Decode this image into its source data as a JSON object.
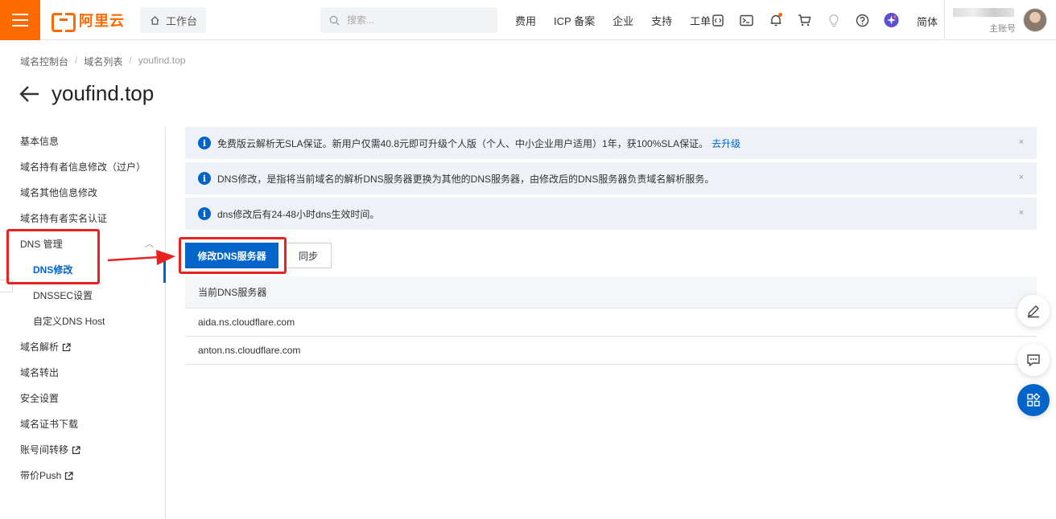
{
  "topbar": {
    "logo_text": "阿里云",
    "workbench_label": "工作台",
    "search_placeholder": "搜索...",
    "nav_links": [
      "费用",
      "ICP 备案",
      "企业",
      "支持",
      "工单"
    ],
    "language": "简体",
    "account_sub": "主账号",
    "accent_color": "#ff6a00"
  },
  "breadcrumb": [
    "域名控制台",
    "域名列表",
    "youfind.top"
  ],
  "page_title": "youfind.top",
  "sidenav": {
    "items": [
      {
        "label": "基本信息"
      },
      {
        "label": "域名持有者信息修改（过户）"
      },
      {
        "label": "域名其他信息修改"
      },
      {
        "label": "域名持有者实名认证"
      },
      {
        "label": "DNS 管理"
      },
      {
        "label": "DNS修改"
      },
      {
        "label": "DNSSEC设置"
      },
      {
        "label": "自定义DNS Host"
      },
      {
        "label": "域名解析"
      },
      {
        "label": "域名转出"
      },
      {
        "label": "安全设置"
      },
      {
        "label": "域名证书下载"
      },
      {
        "label": "账号间转移"
      },
      {
        "label": "带价Push"
      }
    ]
  },
  "alerts": [
    {
      "text": "免费版云解析无SLA保证。新用户仅需40.8元即可升级个人版（个人、中小企业用户适用）1年，获100%SLA保证。",
      "link": "去升级"
    },
    {
      "text": "DNS修改，是指将当前域名的解析DNS服务器更换为其他的DNS服务器，由修改后的DNS服务器负责域名解析服务。"
    },
    {
      "text": "dns修改后有24-48小时dns生效时间。"
    }
  ],
  "buttons": {
    "modify_dns": "修改DNS服务器",
    "sync": "同步"
  },
  "table": {
    "header": "当前DNS服务器",
    "rows": [
      "aida.ns.cloudflare.com",
      "anton.ns.cloudflare.com"
    ]
  },
  "primary_color": "#0064c8",
  "annotation_color": "#e8231f"
}
